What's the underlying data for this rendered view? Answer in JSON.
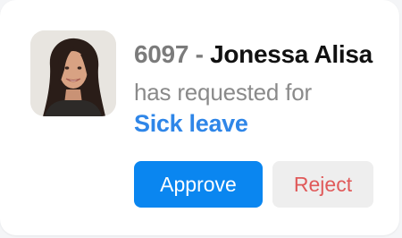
{
  "request": {
    "employee_id": "6097",
    "separator": " - ",
    "employee_name": "Jonessa Alisa",
    "message": "has requested for",
    "leave_type": "Sick leave"
  },
  "actions": {
    "approve_label": "Approve",
    "reject_label": "Reject"
  },
  "colors": {
    "accent": "#0a86f0",
    "link": "#2f86e8",
    "reject_text": "#e05a5a"
  }
}
